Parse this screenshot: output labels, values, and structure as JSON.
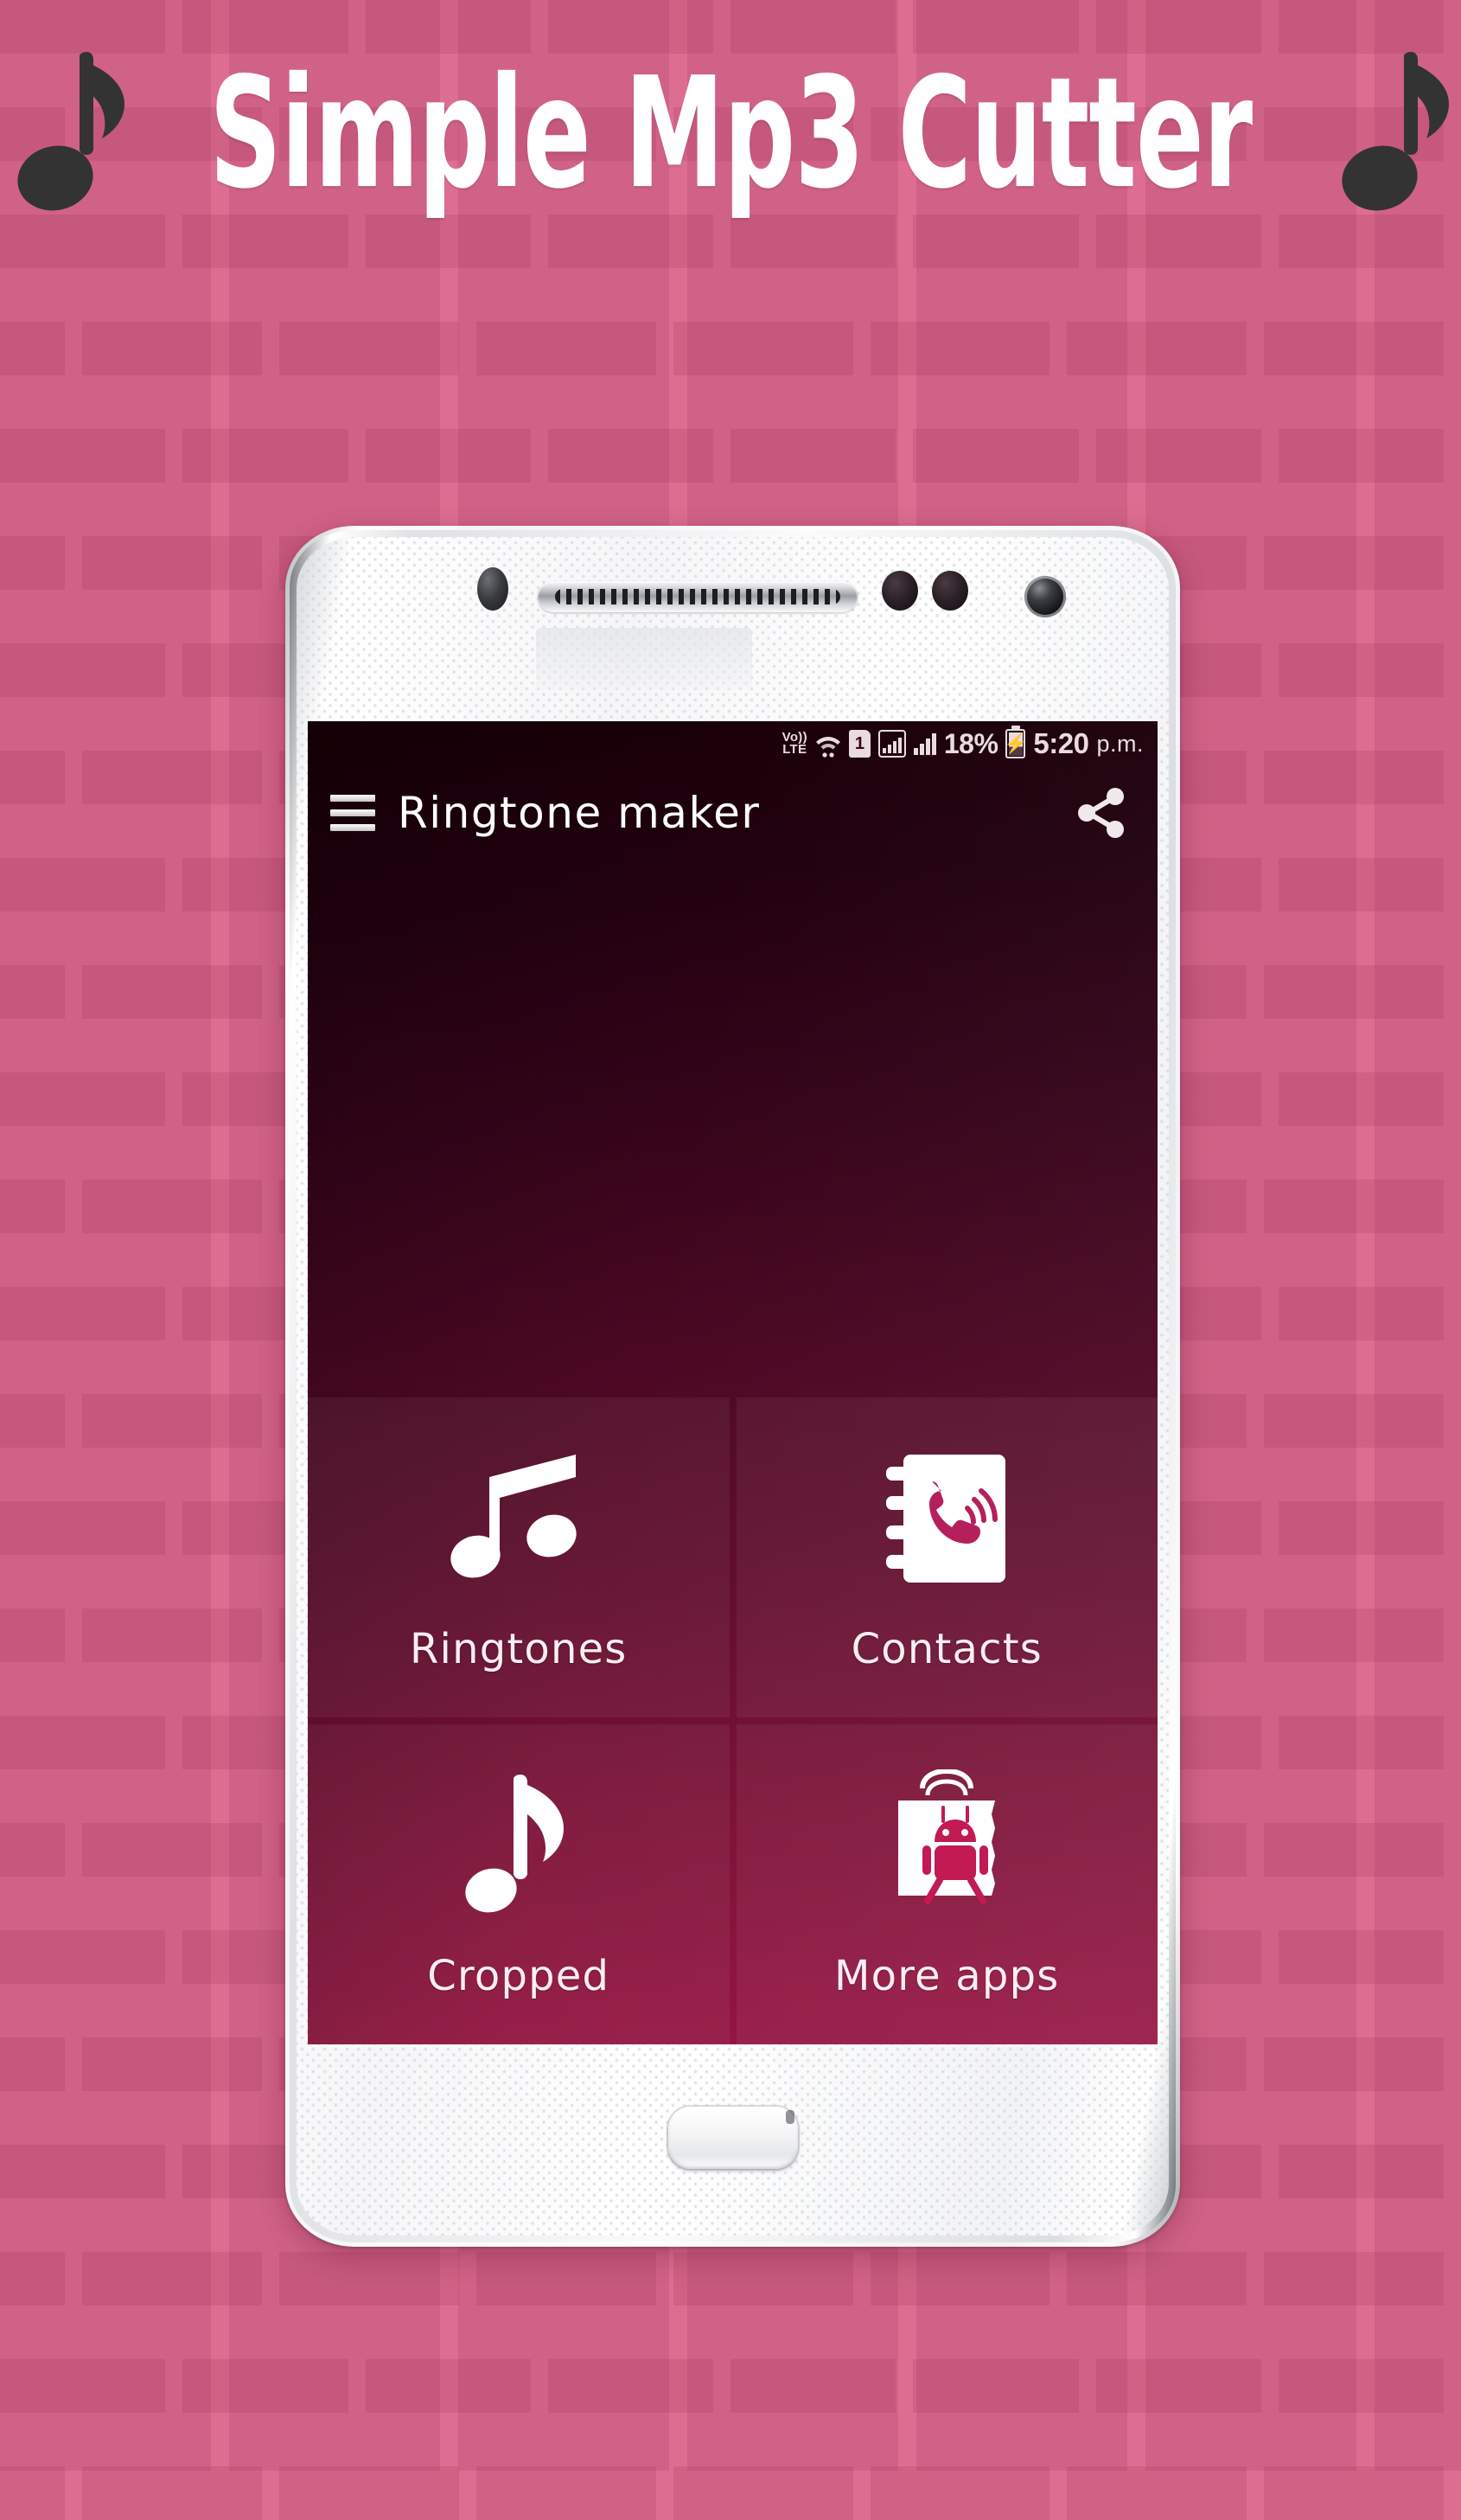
{
  "promo": {
    "title": "Simple Mp3 Cutter",
    "left_note_icon": "music-note-icon",
    "right_note_icon": "music-note-icon",
    "title_color": "#ffffff",
    "note_color": "#333333",
    "background_color": "#dd6e91",
    "brick_color": "#c4658a"
  },
  "phone": {
    "body_color": "#f7f7f8",
    "earpiece_icon": "speaker-grille-icon",
    "front_camera_icon": "front-camera-icon",
    "proximity_sensor_icon": "proximity-sensor-icon",
    "home_button_label": "home-button"
  },
  "status_bar": {
    "volte_top": "Vo))",
    "volte_bottom": "LTE",
    "wifi_icon": "wifi-icon",
    "sim_label": "1",
    "signal_box_icon": "mobile-data-icon",
    "signal_bars_icon": "signal-bars-icon",
    "battery_percent": "18%",
    "battery_icon": "battery-charging-icon",
    "clock": "5:20",
    "meridiem": "p.m.",
    "text_color": "#e9dbe0"
  },
  "app_bar": {
    "menu_icon": "hamburger-menu-icon",
    "title": "Ringtone maker",
    "share_icon": "share-icon",
    "title_color": "#ffffff"
  },
  "tiles": [
    {
      "label": "Ringtones",
      "icon": "beamed-eighth-notes-icon"
    },
    {
      "label": "Contacts",
      "icon": "contacts-phonebook-icon"
    },
    {
      "label": "Cropped",
      "icon": "eighth-note-icon"
    },
    {
      "label": "More apps",
      "icon": "play-store-bag-android-icon"
    }
  ],
  "screen": {
    "gradient_top": "#190007",
    "gradient_bottom": "#951240",
    "tile_accent": "#c21a52"
  }
}
